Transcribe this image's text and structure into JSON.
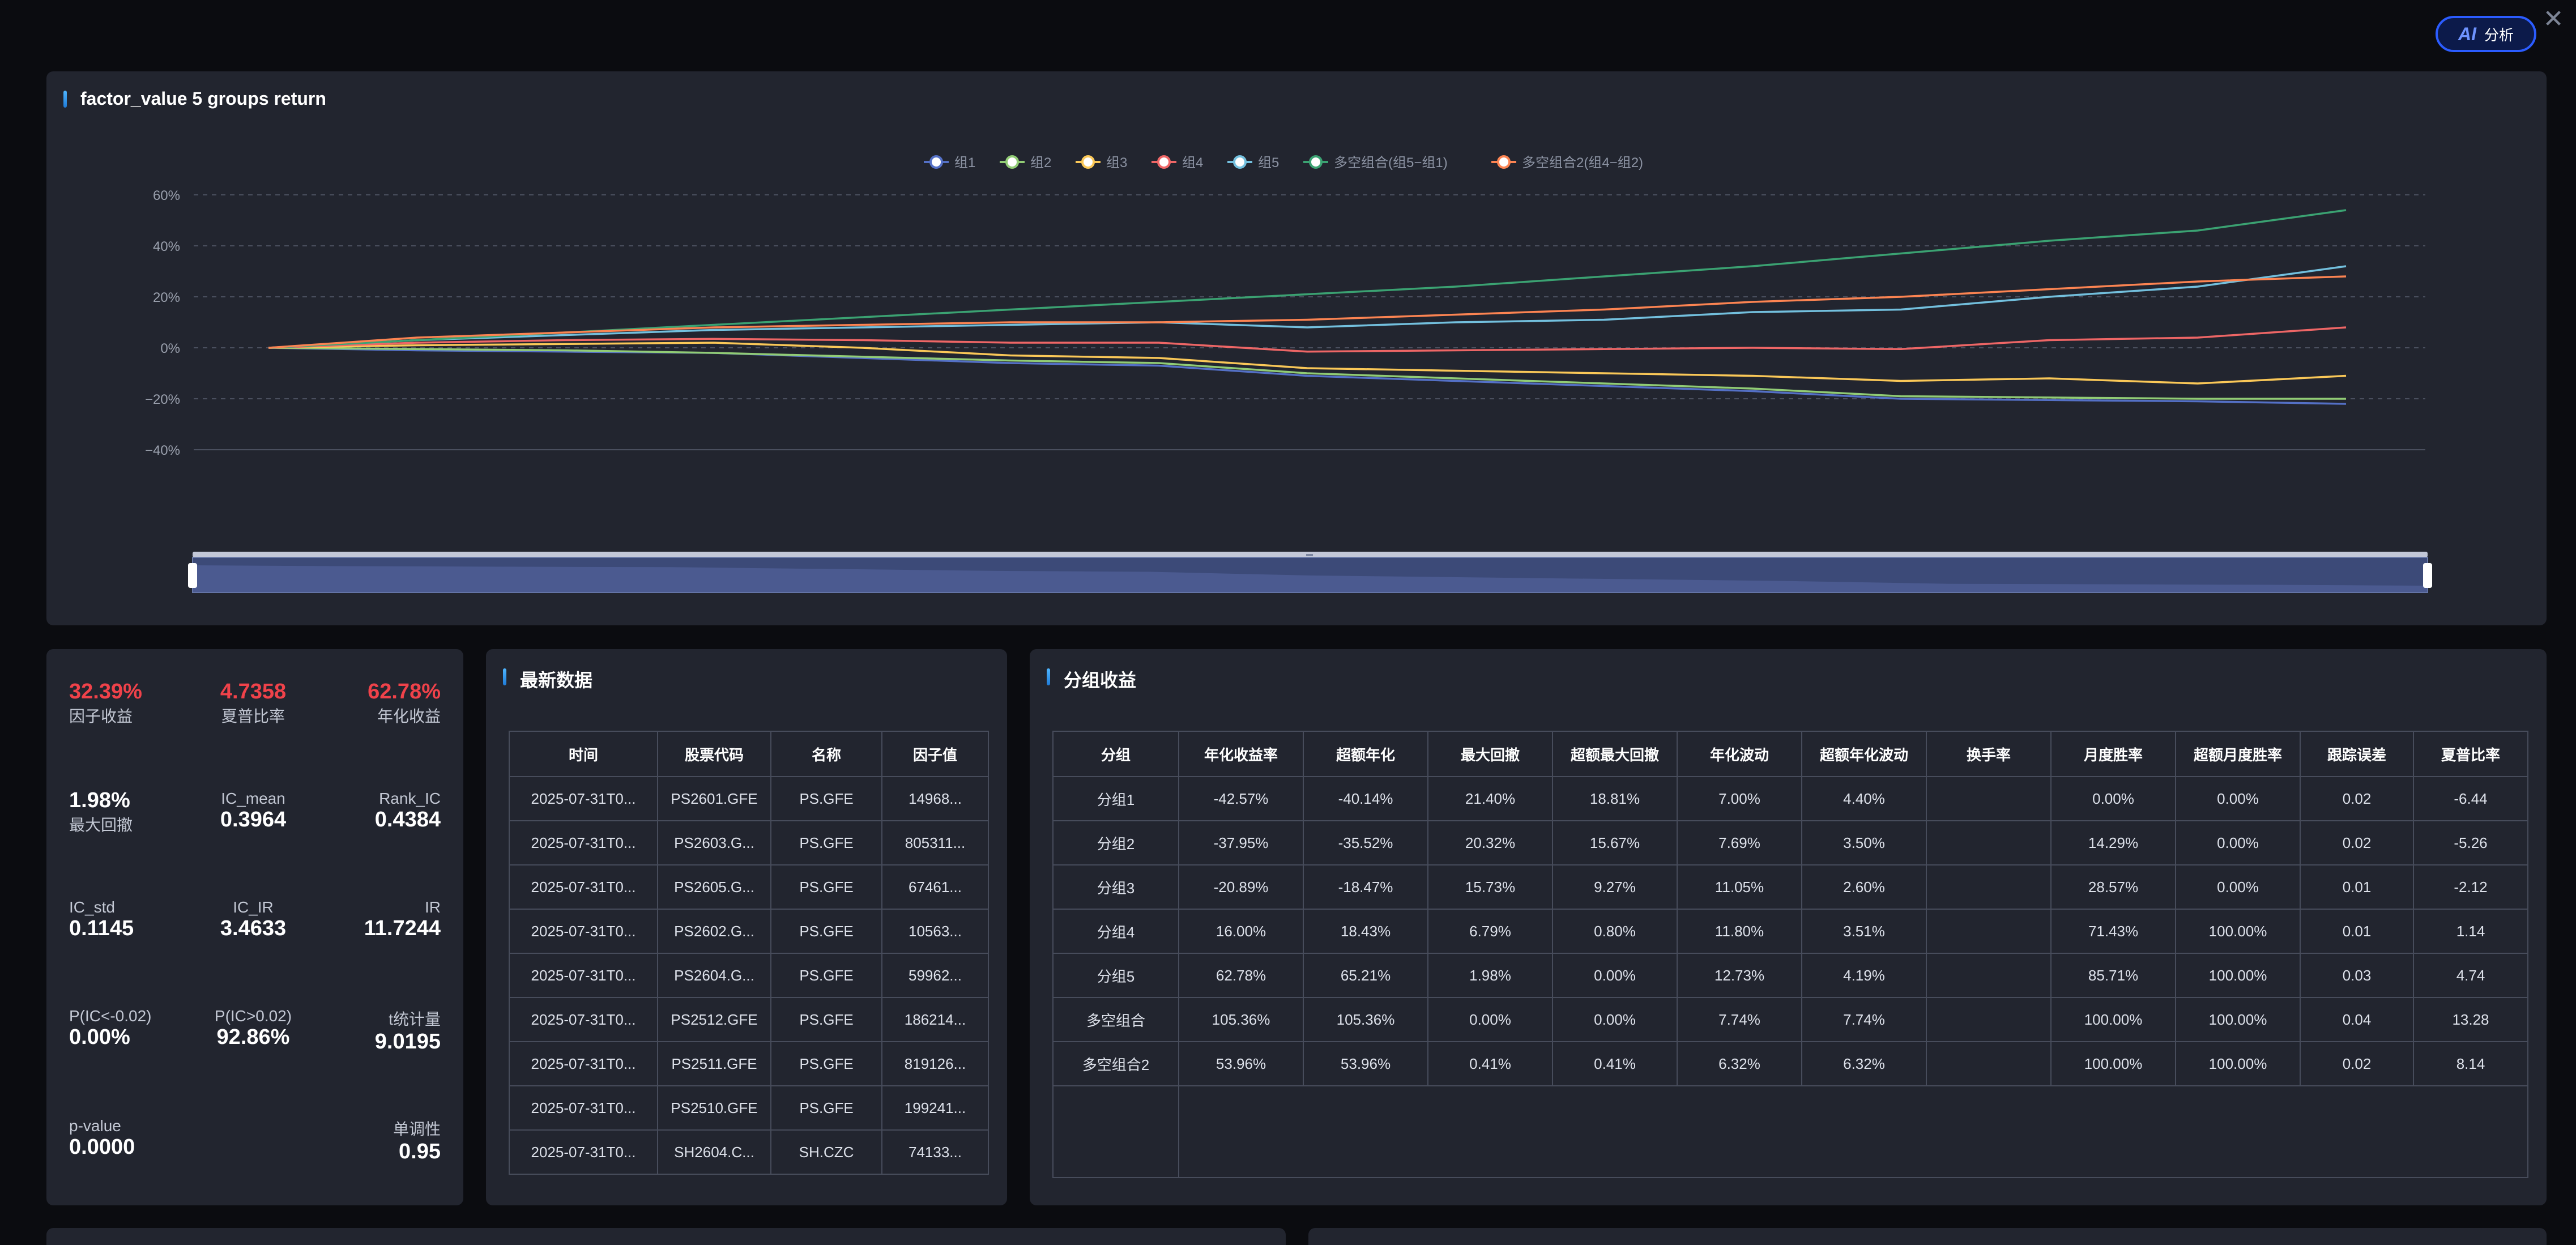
{
  "topbar": {
    "ai_mark": "AI",
    "ai_label": "分析",
    "close": "✕"
  },
  "chart": {
    "title": "factor_value 5 groups return",
    "legend": [
      "组1",
      "组2",
      "组3",
      "组4",
      "组5",
      "多空组合(组5−组1)",
      "多空组合2(组4−组2)"
    ],
    "colors": {
      "组1": "#5470c6",
      "组2": "#91cc75",
      "组3": "#fac858",
      "组4": "#ee6666",
      "组5": "#73c0de",
      "多空组合(组5−组1)": "#3ba272",
      "多空组合2(组4−组2)": "#fc8452"
    },
    "y_ticks": [
      "60%",
      "40%",
      "20%",
      "0%",
      "−20%",
      "−40%"
    ]
  },
  "chart_data": {
    "type": "line",
    "ylim": [
      -40,
      60
    ],
    "y_unit": "%",
    "grid": true,
    "legend_position": "top-center",
    "x_count": 15,
    "series": [
      {
        "name": "组1",
        "values": [
          0,
          -1,
          -1.5,
          -2,
          -4,
          -6,
          -7,
          -11,
          -13,
          -15,
          -17,
          -20,
          -20.5,
          -21,
          -22
        ]
      },
      {
        "name": "组2",
        "values": [
          0,
          -0.5,
          -1,
          -2,
          -3.5,
          -5,
          -6,
          -10,
          -12,
          -14,
          -16,
          -19,
          -19.5,
          -20,
          -20
        ]
      },
      {
        "name": "组3",
        "values": [
          0,
          1,
          1.5,
          2,
          0,
          -3,
          -4,
          -8,
          -9,
          -10,
          -11,
          -13,
          -12,
          -14,
          -11
        ]
      },
      {
        "name": "组4",
        "values": [
          0,
          2,
          3,
          3.5,
          3,
          2,
          2,
          -1.5,
          -1,
          -0.5,
          0,
          -0.5,
          3,
          4,
          8
        ]
      },
      {
        "name": "组5",
        "values": [
          0,
          3,
          5,
          7,
          8,
          9,
          10,
          8,
          10,
          11,
          14,
          15,
          20,
          24,
          32
        ]
      },
      {
        "name": "多空组合(组5−组1)",
        "values": [
          0,
          3,
          6,
          9,
          12,
          15,
          18,
          21,
          24,
          28,
          32,
          37,
          42,
          46,
          54
        ]
      },
      {
        "name": "多空组合2(组4−组2)",
        "values": [
          0,
          4,
          6,
          8,
          9,
          10,
          10,
          11,
          13,
          15,
          18,
          20,
          23,
          26,
          28
        ]
      }
    ]
  },
  "stats": {
    "factor_return": {
      "value": "32.39%",
      "label": "因子收益"
    },
    "sharpe": {
      "value": "4.7358",
      "label": "夏普比率"
    },
    "annual_return": {
      "value": "62.78%",
      "label": "年化收益"
    },
    "max_drawdown": {
      "value": "1.98%",
      "label": "最大回撤"
    },
    "ic_mean": {
      "value": "0.3964",
      "label": "IC_mean"
    },
    "rank_ic": {
      "value": "0.4384",
      "label": "Rank_IC"
    },
    "ic_std": {
      "value": "0.1145",
      "label": "IC_std"
    },
    "ic_ir": {
      "value": "3.4633",
      "label": "IC_IR"
    },
    "ir": {
      "value": "11.7244",
      "label": "IR"
    },
    "p_ic_neg": {
      "value": "0.00%",
      "label": "P(IC<-0.02)"
    },
    "p_ic_pos": {
      "value": "92.86%",
      "label": "P(IC>0.02)"
    },
    "t_stat": {
      "value": "9.0195",
      "label": "t统计量"
    },
    "p_value": {
      "value": "0.0000",
      "label": "p-value"
    },
    "monotonic": {
      "value": "0.95",
      "label": "单调性"
    }
  },
  "latest": {
    "title": "最新数据",
    "columns": [
      "时间",
      "股票代码",
      "名称",
      "因子值"
    ],
    "rows": [
      [
        "2025-07-31T0...",
        "PS2601.GFE",
        "PS.GFE",
        "14968..."
      ],
      [
        "2025-07-31T0...",
        "PS2603.G...",
        "PS.GFE",
        "805311..."
      ],
      [
        "2025-07-31T0...",
        "PS2605.G...",
        "PS.GFE",
        "67461..."
      ],
      [
        "2025-07-31T0...",
        "PS2602.G...",
        "PS.GFE",
        "10563..."
      ],
      [
        "2025-07-31T0...",
        "PS2604.G...",
        "PS.GFE",
        "59962..."
      ],
      [
        "2025-07-31T0...",
        "PS2512.GFE",
        "PS.GFE",
        "186214..."
      ],
      [
        "2025-07-31T0...",
        "PS2511.GFE",
        "PS.GFE",
        "819126..."
      ],
      [
        "2025-07-31T0...",
        "PS2510.GFE",
        "PS.GFE",
        "199241..."
      ],
      [
        "2025-07-31T0...",
        "SH2604.C...",
        "SH.CZC",
        "74133..."
      ]
    ]
  },
  "groups": {
    "title": "分组收益",
    "columns": [
      "分组",
      "年化收益率",
      "超额年化",
      "最大回撤",
      "超额最大回撤",
      "年化波动",
      "超额年化波动",
      "换手率",
      "月度胜率",
      "超额月度胜率",
      "跟踪误差",
      "夏普比率"
    ],
    "rows": [
      [
        "分组1",
        "-42.57%",
        "-40.14%",
        "21.40%",
        "18.81%",
        "7.00%",
        "4.40%",
        "",
        "0.00%",
        "0.00%",
        "0.02",
        "-6.44"
      ],
      [
        "分组2",
        "-37.95%",
        "-35.52%",
        "20.32%",
        "15.67%",
        "7.69%",
        "3.50%",
        "",
        "14.29%",
        "0.00%",
        "0.02",
        "-5.26"
      ],
      [
        "分组3",
        "-20.89%",
        "-18.47%",
        "15.73%",
        "9.27%",
        "11.05%",
        "2.60%",
        "",
        "28.57%",
        "0.00%",
        "0.01",
        "-2.12"
      ],
      [
        "分组4",
        "16.00%",
        "18.43%",
        "6.79%",
        "0.80%",
        "11.80%",
        "3.51%",
        "",
        "71.43%",
        "100.00%",
        "0.01",
        "1.14"
      ],
      [
        "分组5",
        "62.78%",
        "65.21%",
        "1.98%",
        "0.00%",
        "12.73%",
        "4.19%",
        "",
        "85.71%",
        "100.00%",
        "0.03",
        "4.74"
      ],
      [
        "多空组合",
        "105.36%",
        "105.36%",
        "0.00%",
        "0.00%",
        "7.74%",
        "7.74%",
        "",
        "100.00%",
        "100.00%",
        "0.04",
        "13.28"
      ],
      [
        "多空组合2",
        "53.96%",
        "53.96%",
        "0.41%",
        "0.41%",
        "6.32%",
        "6.32%",
        "",
        "100.00%",
        "100.00%",
        "0.02",
        "8.14"
      ]
    ]
  }
}
